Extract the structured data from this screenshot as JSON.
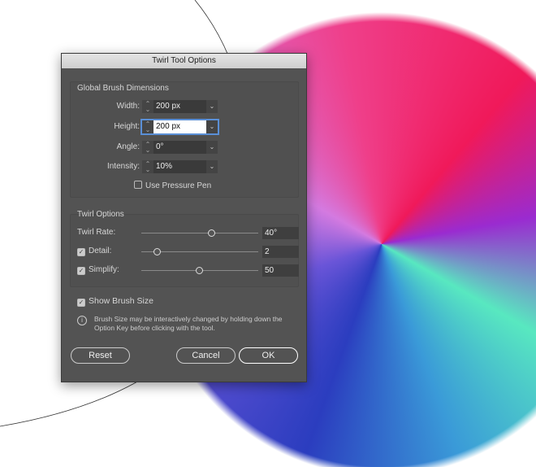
{
  "dialog": {
    "title": "Twirl Tool Options"
  },
  "global": {
    "heading": "Global Brush Dimensions",
    "fields": [
      {
        "label": "Width:",
        "value": "200 px"
      },
      {
        "label": "Height:",
        "value": "200 px"
      },
      {
        "label": "Angle:",
        "value": "0°"
      },
      {
        "label": "Intensity:",
        "value": "10%"
      }
    ],
    "pressure_label": "Use Pressure Pen",
    "pressure_checked": false
  },
  "twirl": {
    "heading": "Twirl Options",
    "rows": [
      {
        "label": "Twirl Rate:",
        "value": "40°",
        "slider_pct": 60,
        "checkbox": null
      },
      {
        "label": "Detail:",
        "value": "2",
        "slider_pct": 13,
        "checkbox": true
      },
      {
        "label": "Simplify:",
        "value": "50",
        "slider_pct": 49,
        "checkbox": true
      }
    ]
  },
  "show_brush_size": {
    "label": "Show Brush Size",
    "checked": true
  },
  "info": "Brush Size may be interactively changed by holding down the Option Key before clicking with the tool.",
  "buttons": {
    "reset": "Reset",
    "cancel": "Cancel",
    "ok": "OK"
  }
}
